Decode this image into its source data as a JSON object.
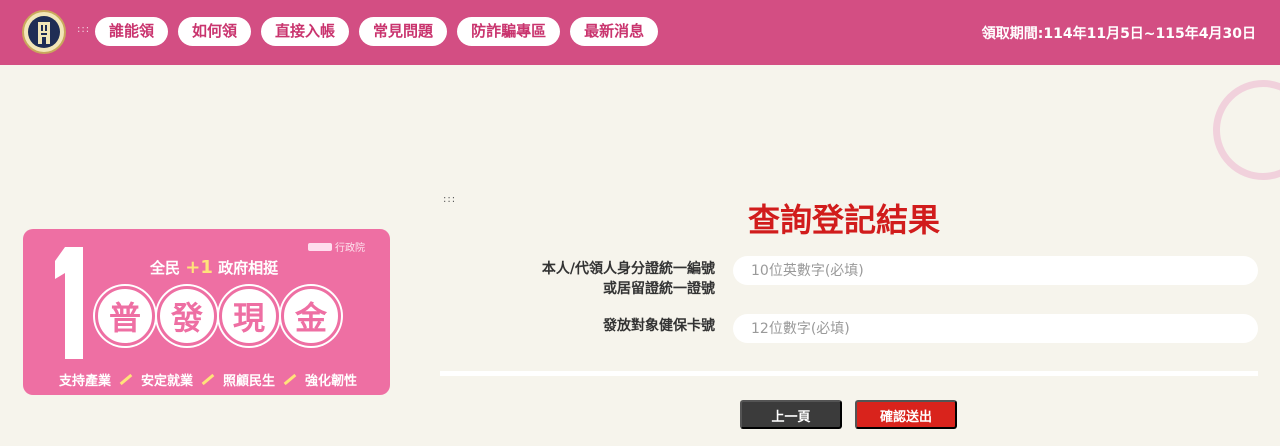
{
  "header": {
    "accesskey": ":::",
    "nav": [
      "誰能領",
      "如何領",
      "直接入帳",
      "常見問題",
      "防詐騙專區",
      "最新消息"
    ],
    "period": "領取期間:114年11月5日~115年4月30日"
  },
  "banner": {
    "big_number": "1",
    "agency": "行政院",
    "slogan_prefix": "全民",
    "slogan_plus": "+1",
    "slogan_suffix": "政府相挺",
    "circles": [
      "普",
      "發",
      "現",
      "金"
    ],
    "bottom": [
      "支持產業",
      "安定就業",
      "照顧民生",
      "強化韌性"
    ]
  },
  "form": {
    "accesskey": ":::",
    "title": "查詢登記結果",
    "label_id_line1": "本人/代領人身分證統一編號",
    "label_id_line2": "或居留證統一證號",
    "id_placeholder": "10位英數字(必填)",
    "label_card": "發放對象健保卡號",
    "card_placeholder": "12位數字(必填)",
    "prev_button": "上一頁",
    "submit_button": "確認送出"
  },
  "colors": {
    "header_bg": "#d34e83",
    "title_red": "#d11c1c",
    "banner_pink": "#ee6fa3",
    "submit_red": "#d9231c",
    "prev_dark": "#3b3b3b"
  }
}
